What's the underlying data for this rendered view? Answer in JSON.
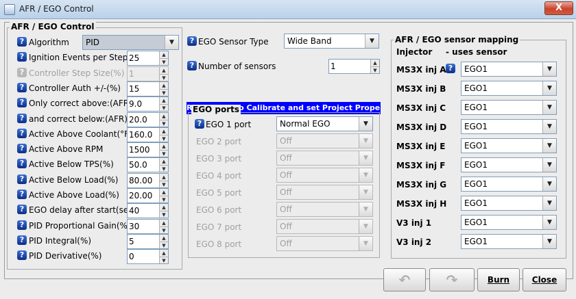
{
  "window": {
    "title": "AFR / EGO Control",
    "close_glyph": "X"
  },
  "afr_group": {
    "title": "AFR / EGO Control",
    "rows": [
      {
        "label": "Algorithm",
        "value": "PID",
        "type": "combo",
        "enabled": true
      },
      {
        "label": "Ignition Events per Step",
        "value": "25",
        "enabled": true
      },
      {
        "label": "Controller Step Size(%)",
        "value": "1",
        "enabled": false
      },
      {
        "label": "Controller Auth +/-(%)",
        "value": "15",
        "enabled": true
      },
      {
        "label": "Only correct above:(AFR)",
        "value": "9.0",
        "enabled": true
      },
      {
        "label": "and correct below:(AFR)",
        "value": "20.0",
        "enabled": true
      },
      {
        "label": "Active Above Coolant(°F)",
        "value": "160.0",
        "enabled": true
      },
      {
        "label": "Active Above RPM",
        "value": "1500",
        "enabled": true
      },
      {
        "label": "Active Below TPS(%)",
        "value": "50.0",
        "enabled": true
      },
      {
        "label": "Active Below Load(%)",
        "value": "80.00",
        "enabled": true
      },
      {
        "label": "Active Above Load(%)",
        "value": "20.00",
        "enabled": true
      },
      {
        "label": "EGO delay after start(sec)",
        "value": "40",
        "enabled": true
      },
      {
        "label": "PID Proportional Gain(%)",
        "value": "30",
        "enabled": true
      },
      {
        "label": "PID Integral(%)",
        "value": "5",
        "enabled": true
      },
      {
        "label": "PID Derivative(%)",
        "value": "0",
        "enabled": true
      }
    ]
  },
  "sensor": {
    "type_label": "EGO Sensor Type",
    "type_value": "Wide Band",
    "count_label": "Number of sensors",
    "count_value": "1",
    "remember_text": "Remember to Calibrate and set Project Properties"
  },
  "ego_ports": {
    "title": "EGO ports",
    "ports": [
      {
        "label": "EGO 1 port",
        "value": "Normal EGO",
        "enabled": true
      },
      {
        "label": "EGO 2 port",
        "value": "Off",
        "enabled": false
      },
      {
        "label": "EGO 3 port",
        "value": "Off",
        "enabled": false
      },
      {
        "label": "EGO 4 port",
        "value": "Off",
        "enabled": false
      },
      {
        "label": "EGO 5 port",
        "value": "Off",
        "enabled": false
      },
      {
        "label": "EGO 6 port",
        "value": "Off",
        "enabled": false
      },
      {
        "label": "EGO 7 port",
        "value": "Off",
        "enabled": false
      },
      {
        "label": "EGO 8 port",
        "value": "Off",
        "enabled": false
      }
    ]
  },
  "mapping": {
    "title": "AFR / EGO sensor mapping",
    "col_injector": "Injector",
    "col_sensor": "- uses sensor",
    "rows": [
      {
        "label": "MS3X inj A",
        "value": "EGO1"
      },
      {
        "label": "MS3X inj B",
        "value": "EGO1"
      },
      {
        "label": "MS3X inj C",
        "value": "EGO1"
      },
      {
        "label": "MS3X inj D",
        "value": "EGO1"
      },
      {
        "label": "MS3X inj E",
        "value": "EGO1"
      },
      {
        "label": "MS3X inj F",
        "value": "EGO1"
      },
      {
        "label": "MS3X inj G",
        "value": "EGO1"
      },
      {
        "label": "MS3X inj H",
        "value": "EGO1"
      },
      {
        "label": "V3 inj 1",
        "value": "EGO1"
      },
      {
        "label": "V3 inj 2",
        "value": "EGO1"
      }
    ]
  },
  "buttons": {
    "undo_glyph": "↶",
    "redo_glyph": "↷",
    "burn_label": "Burn",
    "close_label": "Close"
  },
  "icons": {
    "help": "help-icon",
    "help_glyph": "?",
    "arrow_up": "▲",
    "arrow_down": "▼"
  },
  "colors": {
    "remember_bg": "#0000ff",
    "help_blue": "#1d4fb5"
  }
}
